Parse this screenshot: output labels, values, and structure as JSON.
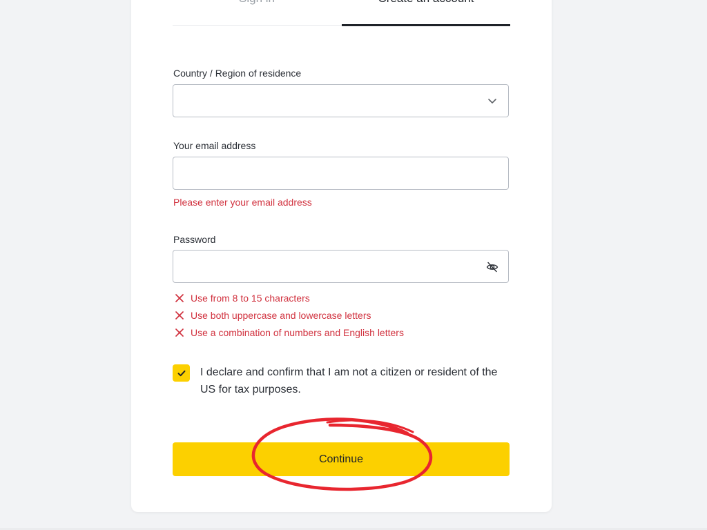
{
  "tabs": {
    "sign_in": "Sign in",
    "create_account": "Create an account",
    "active": "create_account"
  },
  "form": {
    "country": {
      "label": "Country / Region of residence",
      "value": "",
      "icon": "chevron-down-icon"
    },
    "email": {
      "label": "Your email address",
      "value": "",
      "error": "Please enter your email address"
    },
    "password": {
      "label": "Password",
      "value": "",
      "icon": "eye-slash-icon",
      "rules": [
        {
          "text": "Use from 8 to 15 characters",
          "status": "fail",
          "icon": "x-icon"
        },
        {
          "text": "Use both uppercase and lowercase letters",
          "status": "fail",
          "icon": "x-icon"
        },
        {
          "text": "Use a combination of numbers and English letters",
          "status": "fail",
          "icon": "x-icon"
        }
      ]
    },
    "declaration": {
      "checked": true,
      "text": "I declare and confirm that I am not a citizen or resident of the US for tax purposes.",
      "icon": "checkmark-icon"
    },
    "continue_label": "Continue"
  },
  "colors": {
    "accent": "#fcd000",
    "error": "#d1323f",
    "annotation": "#e8262f",
    "text": "#1f2329",
    "muted": "#9aa0a6",
    "page_bg": "#f2f3f5"
  }
}
